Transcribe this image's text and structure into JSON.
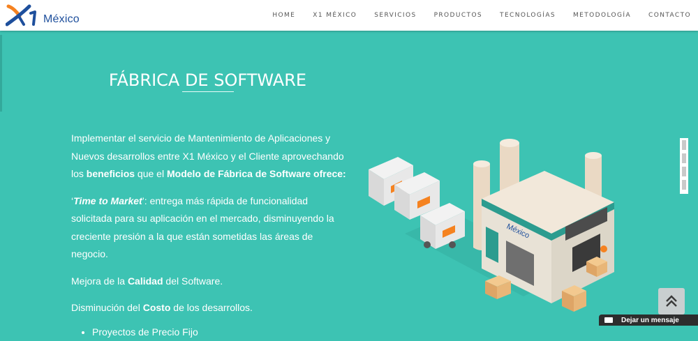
{
  "header": {
    "logo_text": "México",
    "menu": [
      "HOME",
      "X1 MÉXICO",
      "SERVICIOS",
      "PRODUCTOS",
      "TECNOLOGÍAS",
      "METODOLOGÍA",
      "CONTACTO"
    ]
  },
  "main": {
    "title": "FÁBRICA DE SOFTWARE",
    "intro": {
      "t1": "Implementar el servicio de Mantenimiento de Aplicaciones y Nuevos desarrollos entre X1 México y el Cliente aprovechando los ",
      "b1": "beneficios",
      "t2": " que el ",
      "b2": "Modelo de Fábrica de Software ofrece:"
    },
    "ttm": {
      "q1": "‘",
      "b": "Time to Market",
      "q2": "’",
      "t": ": entrega más rápida de funcionalidad solicitada para su aplicación en el mercado, disminuyendo la creciente presión a la que están sometidas las áreas de negocio."
    },
    "quality": {
      "t1": "Mejora de la ",
      "b": "Calidad",
      "t2": " del Software."
    },
    "cost": {
      "t1": "Disminución del ",
      "b": "Costo",
      "t2": " de los desarrollos."
    },
    "bullets": [
      "Proyectos de Precio Fijo"
    ],
    "illustration_sign": "México"
  },
  "chat": {
    "label": "Dejar un mensaje"
  },
  "colors": {
    "background": "#3dc3b3",
    "nav": "#ffffff",
    "logo_blue": "#1e4f9c",
    "logo_orange": "#f58220"
  },
  "icons": [
    "x1-logo-icon",
    "double-chevron-up-icon",
    "envelope-icon"
  ]
}
